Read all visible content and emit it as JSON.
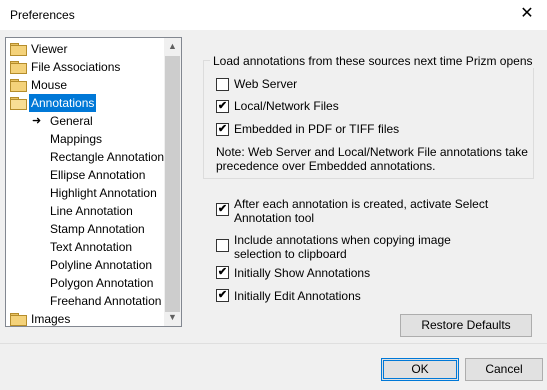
{
  "window": {
    "title": "Preferences",
    "close_glyph": "✕"
  },
  "tree": {
    "scroll_up": "▲",
    "scroll_down": "▼",
    "items": [
      {
        "label": "Viewer"
      },
      {
        "label": "File Associations"
      },
      {
        "label": "Mouse"
      },
      {
        "label": "Annotations",
        "selected": true,
        "open": true
      },
      {
        "label": "General",
        "current": true
      },
      {
        "label": "Mappings"
      },
      {
        "label": "Rectangle Annotation"
      },
      {
        "label": "Ellipse Annotation"
      },
      {
        "label": "Highlight Annotation"
      },
      {
        "label": "Line Annotation"
      },
      {
        "label": "Stamp Annotation"
      },
      {
        "label": "Text Annotation"
      },
      {
        "label": "Polyline Annotation"
      },
      {
        "label": "Polygon Annotation"
      },
      {
        "label": "Freehand Annotation"
      },
      {
        "label": "Images"
      }
    ],
    "current_arrow": "➜"
  },
  "sources": {
    "title": "Load annotations from these sources next time Prizm opens",
    "options": [
      {
        "label": "Web Server",
        "checked": false
      },
      {
        "label": "Local/Network Files",
        "checked": true
      },
      {
        "label": "Embedded in PDF or TIFF files",
        "checked": true
      }
    ],
    "note_line1": "Note: Web Server and Local/Network File annotations take",
    "note_line2": "precedence over Embedded annotations."
  },
  "options": [
    {
      "line1": "After each annotation is created, activate Select",
      "line2": "Annotation tool",
      "checked": true
    },
    {
      "line1": "Include annotations when copying image",
      "line2": "selection to clipboard",
      "checked": false
    },
    {
      "line1": "Initially Show Annotations",
      "line2": "",
      "checked": true
    },
    {
      "line1": "Initially Edit Annotations",
      "line2": "",
      "checked": true
    }
  ],
  "check_glyph": "✔",
  "buttons": {
    "restore": "Restore Defaults",
    "ok": "OK",
    "cancel": "Cancel"
  }
}
